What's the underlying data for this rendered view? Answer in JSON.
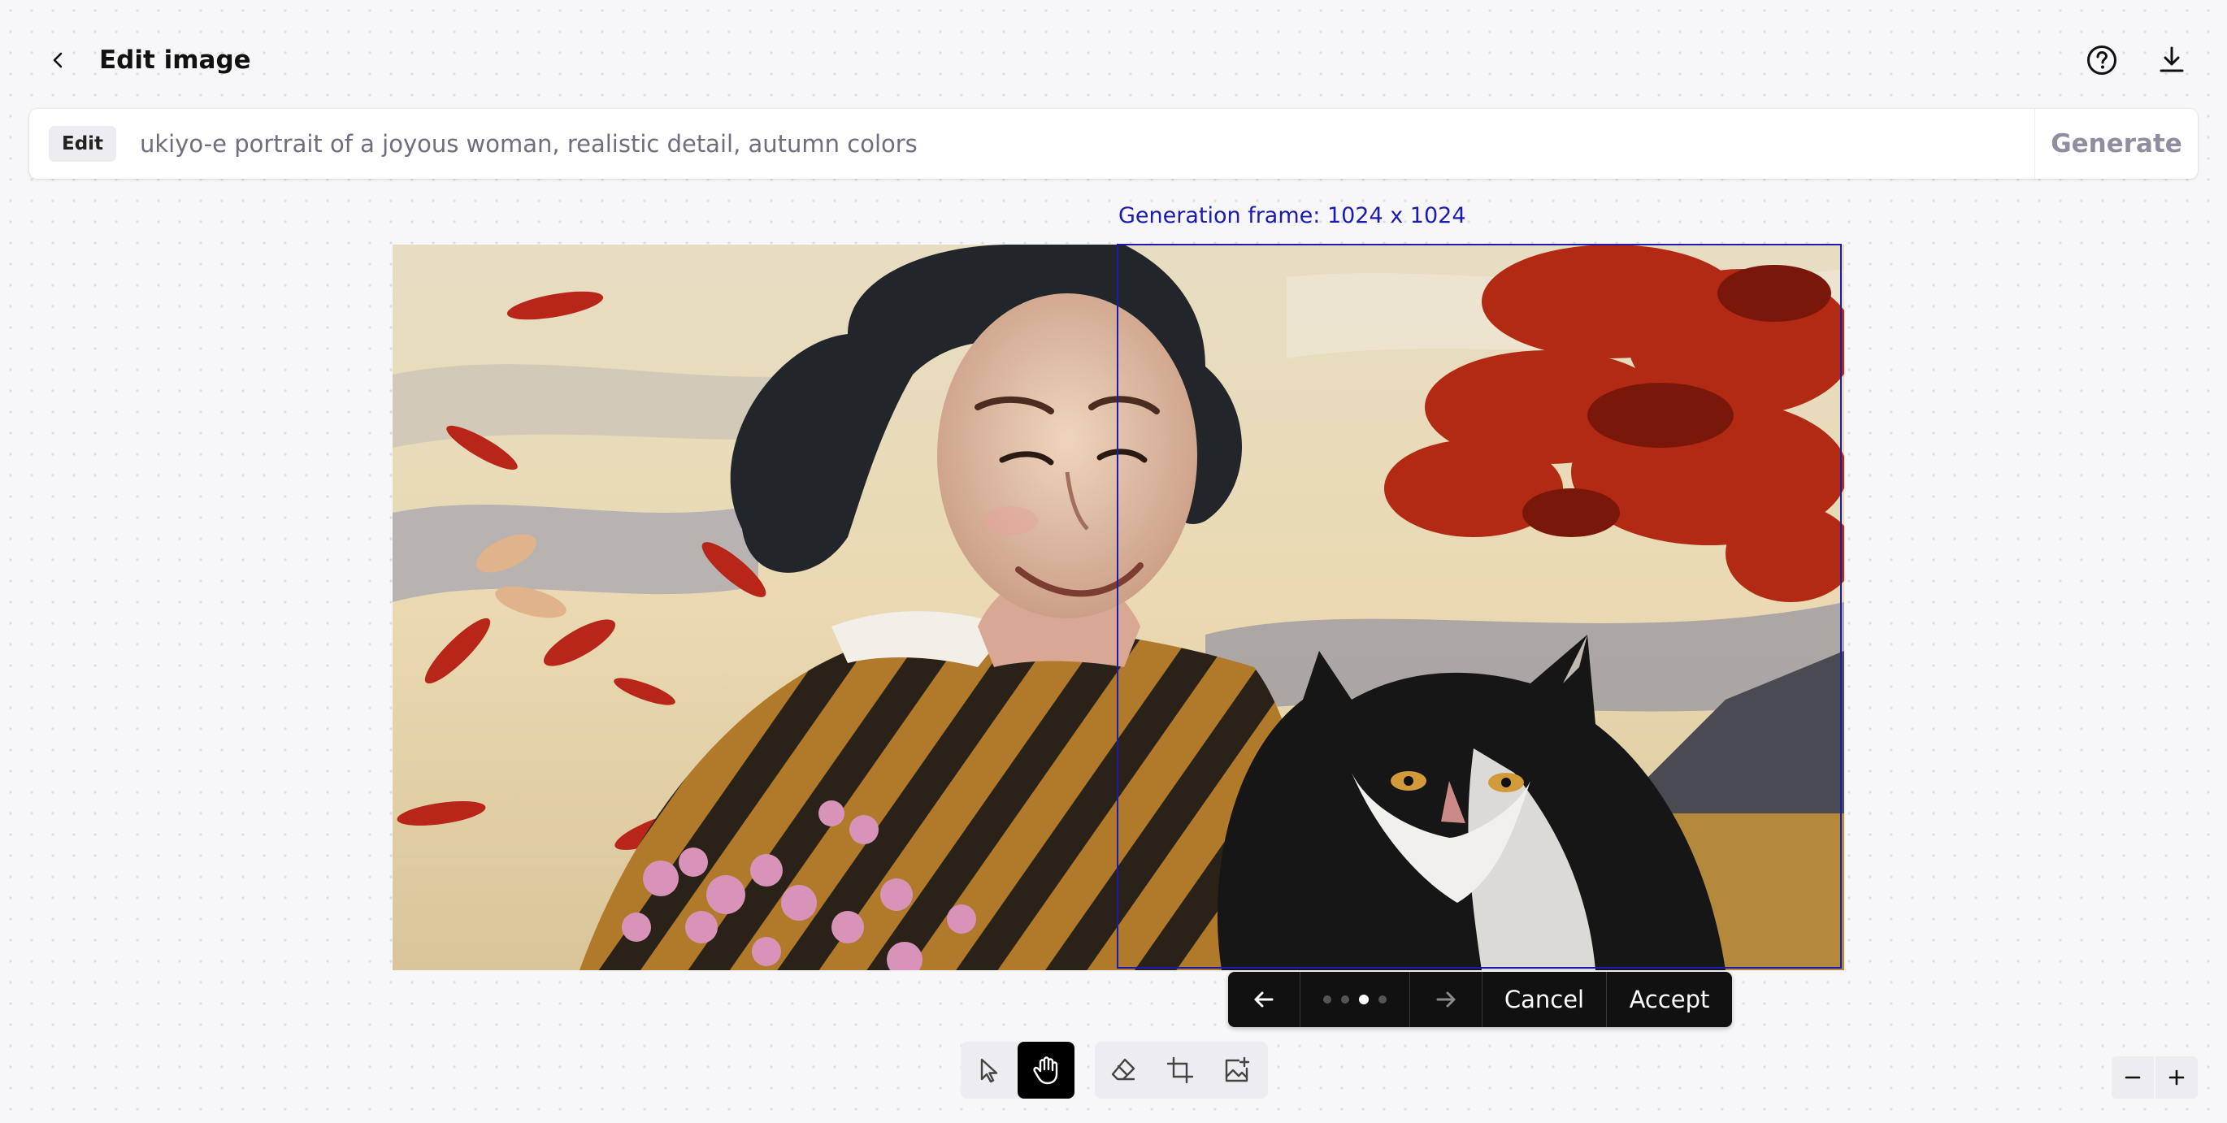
{
  "header": {
    "title": "Edit image",
    "back_icon": "chevron-left-icon",
    "help_icon": "help-circle-icon",
    "download_icon": "download-icon"
  },
  "prompt": {
    "mode_chip": "Edit",
    "value": "ukiyo-e portrait of a joyous woman, realistic detail, autumn colors",
    "generate_label": "Generate"
  },
  "canvas": {
    "frame_label": "Generation frame: 1024 x 1024",
    "frame_color": "#1b1bb0"
  },
  "variant_toolbar": {
    "total": 4,
    "current": 3,
    "cancel_label": "Cancel",
    "accept_label": "Accept"
  },
  "tools": {
    "group1": [
      "select-arrow-icon",
      "hand-pan-icon"
    ],
    "active": "hand-pan-icon",
    "group2": [
      "eraser-icon",
      "add-frame-icon",
      "upload-image-icon"
    ]
  },
  "zoom": {
    "minus": "−",
    "plus": "+"
  }
}
